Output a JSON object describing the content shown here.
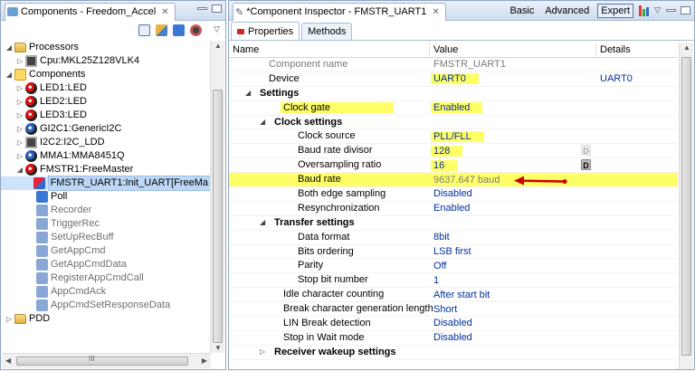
{
  "left": {
    "title": "Components - Freedom_Accel",
    "tree": [
      {
        "indent": 0,
        "tw": "◢",
        "icon": "folder",
        "icon_name": "folder-icon",
        "label": "Processors"
      },
      {
        "indent": 1,
        "tw": "▷",
        "icon": "chip",
        "icon_name": "cpu-icon",
        "label": "Cpu:MKL25Z128VLK4"
      },
      {
        "indent": 0,
        "tw": "◢",
        "icon": "multi",
        "icon_name": "components-folder-icon",
        "label": "Components"
      },
      {
        "indent": 1,
        "tw": "▷",
        "icon": "comp",
        "icon_name": "component-icon",
        "label": "LED1:LED"
      },
      {
        "indent": 1,
        "tw": "▷",
        "icon": "comp",
        "icon_name": "component-icon",
        "label": "LED2:LED"
      },
      {
        "indent": 1,
        "tw": "▷",
        "icon": "comp",
        "icon_name": "component-icon",
        "label": "LED3:LED"
      },
      {
        "indent": 1,
        "tw": "▷",
        "icon": "comp2",
        "icon_name": "component-icon",
        "label": "GI2C1:GenericI2C"
      },
      {
        "indent": 1,
        "tw": "▷",
        "icon": "chip",
        "icon_name": "ldd-icon",
        "label": "I2C2:I2C_LDD"
      },
      {
        "indent": 1,
        "tw": "▷",
        "icon": "comp2",
        "icon_name": "component-icon",
        "label": "MMA1:MMA8451Q"
      },
      {
        "indent": 1,
        "tw": "◢",
        "icon": "comp",
        "icon_name": "component-icon",
        "label": "FMSTR1:FreeMaster"
      },
      {
        "indent": 2,
        "tw": "",
        "icon": "fmstr",
        "icon_name": "uart-component-icon",
        "label": "FMSTR_UART1:Init_UART[FreeMa",
        "sel": true
      },
      {
        "indent": 2,
        "tw": "",
        "icon": "method",
        "icon_name": "method-icon",
        "label": "Poll"
      },
      {
        "indent": 2,
        "tw": "",
        "icon": "methodg",
        "icon_name": "method-icon",
        "label": "Recorder",
        "gray": true
      },
      {
        "indent": 2,
        "tw": "",
        "icon": "methodg",
        "icon_name": "method-icon",
        "label": "TriggerRec",
        "gray": true
      },
      {
        "indent": 2,
        "tw": "",
        "icon": "methodg",
        "icon_name": "method-icon",
        "label": "SetUpRecBuff",
        "gray": true
      },
      {
        "indent": 2,
        "tw": "",
        "icon": "methodg",
        "icon_name": "method-icon",
        "label": "GetAppCmd",
        "gray": true
      },
      {
        "indent": 2,
        "tw": "",
        "icon": "methodg",
        "icon_name": "method-icon",
        "label": "GetAppCmdData",
        "gray": true
      },
      {
        "indent": 2,
        "tw": "",
        "icon": "methodg",
        "icon_name": "method-icon",
        "label": "RegisterAppCmdCall",
        "gray": true
      },
      {
        "indent": 2,
        "tw": "",
        "icon": "methodg",
        "icon_name": "method-icon",
        "label": "AppCmdAck",
        "gray": true
      },
      {
        "indent": 2,
        "tw": "",
        "icon": "methodg",
        "icon_name": "method-icon",
        "label": "AppCmdSetResponseData",
        "gray": true
      },
      {
        "indent": 0,
        "tw": "▷",
        "icon": "folder",
        "icon_name": "folder-icon",
        "label": "PDD"
      }
    ]
  },
  "right": {
    "title": "*Component Inspector - FMSTR_UART1",
    "modes": [
      "Basic",
      "Advanced",
      "Expert"
    ],
    "tabs": [
      "Properties",
      "Methods"
    ],
    "columns": [
      "Name",
      "Value",
      "Details"
    ],
    "rows": [
      {
        "indent": 0,
        "tw": "",
        "name": "Component name",
        "value": "FMSTR_UART1",
        "details": "",
        "gray": true
      },
      {
        "indent": 0,
        "tw": "",
        "name": "Device",
        "value": "UART0",
        "details": "UART0",
        "vhl": true
      },
      {
        "indent": 0,
        "tw": "◢",
        "name": "Settings",
        "value": "",
        "details": "",
        "bold": true
      },
      {
        "indent": 1,
        "tw": "",
        "name": "Clock gate",
        "value": "Enabled",
        "details": "",
        "nhl": true,
        "vhl": true
      },
      {
        "indent": 1,
        "tw": "◢",
        "name": "Clock settings",
        "value": "",
        "details": "",
        "bold": true
      },
      {
        "indent": 2,
        "tw": "",
        "name": "Clock source",
        "value": "PLL/FLL",
        "details": "",
        "vhl": true
      },
      {
        "indent": 2,
        "tw": "",
        "name": "Baud rate divisor",
        "value": "128",
        "details": "",
        "vhl": true,
        "dbtn": "dim"
      },
      {
        "indent": 2,
        "tw": "",
        "name": "Oversampling ratio",
        "value": "16",
        "details": "",
        "vhl": true,
        "dbtn": "dark"
      },
      {
        "indent": 2,
        "tw": "",
        "name": "Baud rate",
        "value": "9637.647 baud",
        "details": "",
        "rowhl": true,
        "vgray": true,
        "arrow": true
      },
      {
        "indent": 2,
        "tw": "",
        "name": "Both edge sampling",
        "value": "Disabled",
        "details": ""
      },
      {
        "indent": 2,
        "tw": "",
        "name": "Resynchronization",
        "value": "Enabled",
        "details": ""
      },
      {
        "indent": 1,
        "tw": "◢",
        "name": "Transfer settings",
        "value": "",
        "details": "",
        "bold": true
      },
      {
        "indent": 2,
        "tw": "",
        "name": "Data format",
        "value": "8bit",
        "details": ""
      },
      {
        "indent": 2,
        "tw": "",
        "name": "Bits ordering",
        "value": "LSB first",
        "details": ""
      },
      {
        "indent": 2,
        "tw": "",
        "name": "Parity",
        "value": "Off",
        "details": ""
      },
      {
        "indent": 2,
        "tw": "",
        "name": "Stop bit number",
        "value": "1",
        "details": ""
      },
      {
        "indent": 1,
        "tw": "",
        "name": "Idle character counting",
        "value": "After start bit",
        "details": ""
      },
      {
        "indent": 1,
        "tw": "",
        "name": "Break character generation length",
        "value": "Short",
        "details": ""
      },
      {
        "indent": 1,
        "tw": "",
        "name": "LIN Break detection",
        "value": "Disabled",
        "details": ""
      },
      {
        "indent": 1,
        "tw": "",
        "name": "Stop in Wait mode",
        "value": "Disabled",
        "details": ""
      },
      {
        "indent": 1,
        "tw": "▷",
        "name": "Receiver wakeup settings",
        "value": "",
        "details": "",
        "bold": true
      }
    ]
  },
  "colors": {
    "highlight": "#ffff66",
    "value_text": "#00309c",
    "arrow": "#cc0000"
  }
}
